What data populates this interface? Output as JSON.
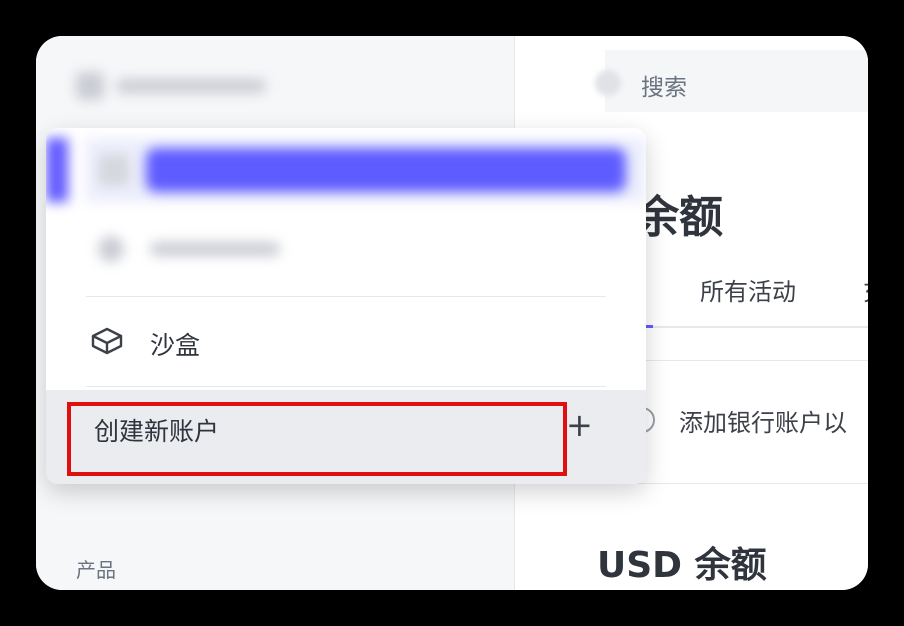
{
  "header": {
    "search_placeholder": "搜索"
  },
  "main": {
    "balance_title": "余额",
    "tabs": [
      {
        "label": "所有活动"
      },
      {
        "label": "充"
      }
    ],
    "bank_hint": "添加银行账户以",
    "usd_title": "USD 余额"
  },
  "sidebar": {
    "section_label": "产品"
  },
  "account_menu": {
    "sandbox_label": "沙盒",
    "create_account_label": "创建新账户",
    "plus_glyph": "+"
  },
  "colors": {
    "accent": "#635bff",
    "highlight": "#e01010",
    "text_primary": "#2f343d",
    "text_secondary": "#6b7280"
  },
  "icons": {
    "sandbox": "cube-icon",
    "add": "plus-icon",
    "search": "search-icon"
  }
}
